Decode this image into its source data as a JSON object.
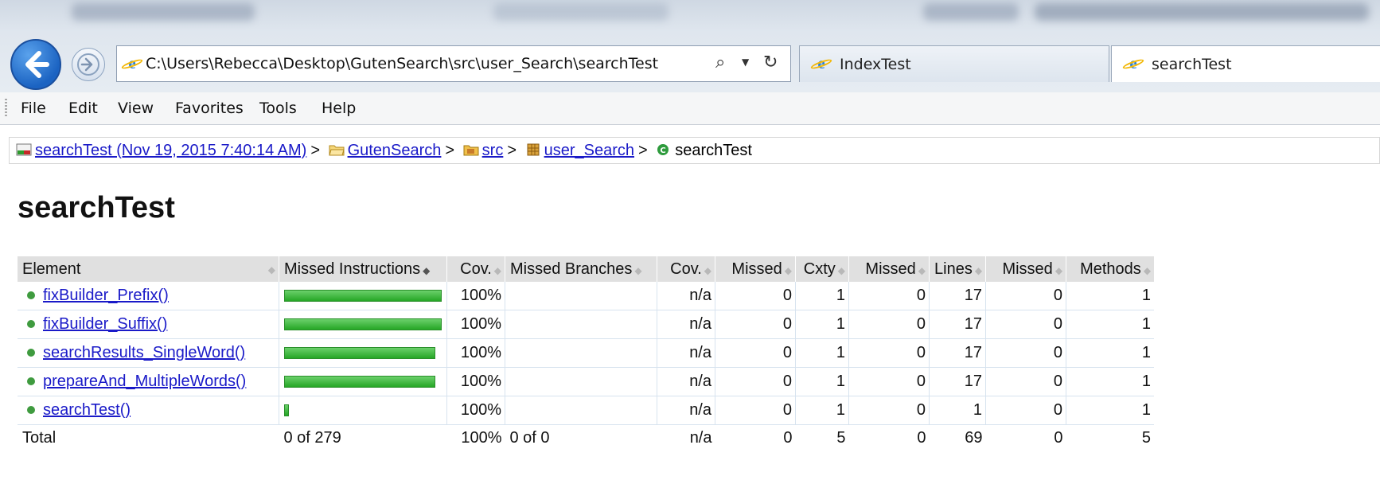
{
  "browser": {
    "address": "C:\\Users\\Rebecca\\Desktop\\GutenSearch\\src\\user_Search\\searchTest",
    "tabs": [
      {
        "label": "IndexTest"
      },
      {
        "label": "searchTest"
      }
    ],
    "menu": [
      "File",
      "Edit",
      "View",
      "Favorites",
      "Tools",
      "Help"
    ]
  },
  "breadcrumb": {
    "session": "searchTest (Nov 19, 2015 7:40:14 AM)",
    "project": "GutenSearch",
    "folder": "src",
    "package": "user_Search",
    "current": "searchTest",
    "separator": ">"
  },
  "page": {
    "title": "searchTest"
  },
  "table": {
    "headers": [
      "Element",
      "Missed Instructions",
      "Cov.",
      "Missed Branches",
      "Cov.",
      "Missed",
      "Cxty",
      "Missed",
      "Lines",
      "Missed",
      "Methods"
    ],
    "rows": [
      {
        "element": "fixBuilder_Prefix()",
        "bar_fraction": 1.0,
        "cov": "100%",
        "branch_cov": "n/a",
        "missed_cxty": "0",
        "cxty": "1",
        "missed_lines": "0",
        "lines": "17",
        "missed_methods": "0",
        "methods": "1"
      },
      {
        "element": "fixBuilder_Suffix()",
        "bar_fraction": 1.0,
        "cov": "100%",
        "branch_cov": "n/a",
        "missed_cxty": "0",
        "cxty": "1",
        "missed_lines": "0",
        "lines": "17",
        "missed_methods": "0",
        "methods": "1"
      },
      {
        "element": "searchResults_SingleWord()",
        "bar_fraction": 0.96,
        "cov": "100%",
        "branch_cov": "n/a",
        "missed_cxty": "0",
        "cxty": "1",
        "missed_lines": "0",
        "lines": "17",
        "missed_methods": "0",
        "methods": "1"
      },
      {
        "element": "prepareAnd_MultipleWords()",
        "bar_fraction": 0.96,
        "cov": "100%",
        "branch_cov": "n/a",
        "missed_cxty": "0",
        "cxty": "1",
        "missed_lines": "0",
        "lines": "17",
        "missed_methods": "0",
        "methods": "1"
      },
      {
        "element": "searchTest()",
        "bar_fraction": 0.03,
        "cov": "100%",
        "branch_cov": "n/a",
        "missed_cxty": "0",
        "cxty": "1",
        "missed_lines": "0",
        "lines": "1",
        "missed_methods": "0",
        "methods": "1"
      }
    ],
    "total": {
      "label": "Total",
      "instructions": "0 of 279",
      "cov": "100%",
      "branches": "0 of 0",
      "branch_cov": "n/a",
      "missed_cxty": "0",
      "cxty": "5",
      "missed_lines": "0",
      "lines": "69",
      "missed_methods": "0",
      "methods": "5"
    }
  },
  "colors": {
    "bar_green": "#26a626",
    "link": "#1a1ac8",
    "header_bg": "#e0e0e0"
  }
}
